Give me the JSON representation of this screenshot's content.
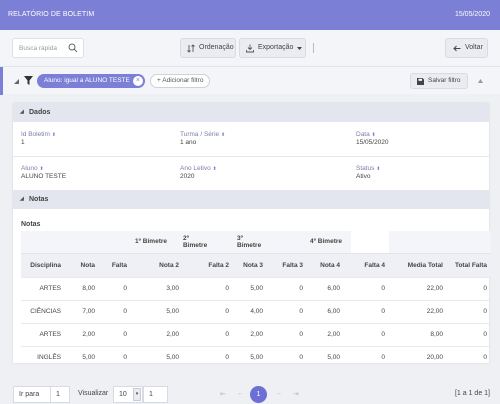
{
  "header": {
    "title": "RELATÓRIO DE BOLETIM",
    "date": "15/05/2020"
  },
  "toolbar": {
    "search_placeholder": "Busca rápida",
    "sort_label": "Ordenação",
    "export_label": "Exportação",
    "back_label": "Voltar"
  },
  "filter": {
    "chip_label": "Aluno: igual a ALUNO TESTE",
    "add_label": "Adicionar filtro",
    "save_label": "Salvar filtro"
  },
  "dados": {
    "section_title": "Dados",
    "fields": {
      "id_boletim": {
        "label": "Id Boletim",
        "value": "1"
      },
      "turma": {
        "label": "Turma / Série",
        "value": "1 ano"
      },
      "data": {
        "label": "Data",
        "value": "15/05/2020"
      },
      "aluno": {
        "label": "Aluno",
        "value": "ALUNO TESTE"
      },
      "ano_letivo": {
        "label": "Ano Letivo",
        "value": "2020"
      },
      "status": {
        "label": "Status",
        "value": "Ativo"
      }
    }
  },
  "notas": {
    "section_title": "Notas",
    "table_title": "Notas",
    "groups": [
      "1º Bimetre",
      "2º Bimetre",
      "3º Bimetre",
      "4º Bimetre"
    ],
    "columns": [
      "Disciplina",
      "Nota",
      "Falta",
      "Nota 2",
      "Falta 2",
      "Nota 3",
      "Falta 3",
      "Nota 4",
      "Falta 4",
      "Media Total",
      "Total Falta"
    ],
    "rows": [
      [
        "ARTES",
        "8,00",
        "0",
        "3,00",
        "0",
        "5,00",
        "0",
        "6,00",
        "0",
        "22,00",
        "0"
      ],
      [
        "CIÊNCIAS",
        "7,00",
        "0",
        "5,00",
        "0",
        "4,00",
        "0",
        "6,00",
        "0",
        "22,00",
        "0"
      ],
      [
        "ARTES",
        "2,00",
        "0",
        "2,00",
        "0",
        "2,00",
        "0",
        "2,00",
        "0",
        "8,00",
        "0"
      ],
      [
        "INGLÊS",
        "5,00",
        "0",
        "5,00",
        "0",
        "5,00",
        "0",
        "5,00",
        "0",
        "20,00",
        "0"
      ]
    ]
  },
  "pager": {
    "goto_label": "Ir para",
    "goto_value": "1",
    "view_label": "Visualizar",
    "page_size": "10",
    "page_size_extra": "1",
    "current_page": "1",
    "range": "[1 a 1 de 1]"
  },
  "colors": {
    "accent": "#7c7fd6",
    "header_bg": "#7c7fd6"
  }
}
